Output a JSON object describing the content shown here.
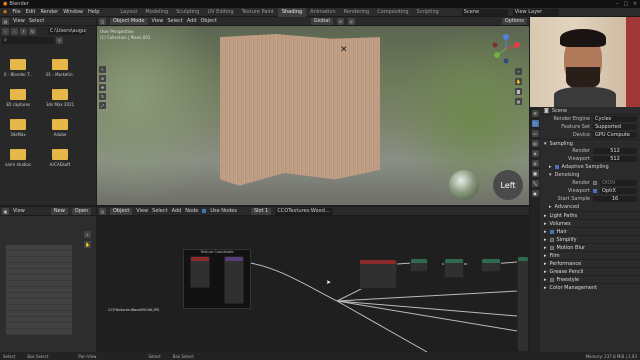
{
  "window": {
    "title": "Blender"
  },
  "menu": {
    "items": [
      "File",
      "Edit",
      "Render",
      "Window",
      "Help"
    ]
  },
  "workspaces": [
    "Layout",
    "Modeling",
    "Sculpting",
    "UV Editing",
    "Texture Paint",
    "Shading",
    "Animation",
    "Rendering",
    "Compositing",
    "Scripting"
  ],
  "active_workspace": "Shading",
  "top_right": {
    "scene": "Scene",
    "view_layer": "View Layer"
  },
  "file_browser": {
    "header": {
      "view": "View",
      "select": "Select"
    },
    "path": "C:\\Users\\august\\...",
    "items": [
      {
        "name": "0 - Blender T..."
      },
      {
        "name": "01 - Marketin..."
      },
      {
        "name": "3D captures"
      },
      {
        "name": "3ds Max 2021"
      },
      {
        "name": "3dsMax"
      },
      {
        "name": "Adobe"
      },
      {
        "name": "anim studios"
      },
      {
        "name": "ArCADsoft"
      }
    ]
  },
  "image_editor": {
    "view": "View",
    "new": "New",
    "open": "Open"
  },
  "viewport": {
    "mode": "Object Mode",
    "menu": [
      "View",
      "Select",
      "Add",
      "Object"
    ],
    "orientation": "Global",
    "options": "Options",
    "overlay_line1": "User Perspective",
    "overlay_line2": "(1) Collection | Plane.001",
    "left_badge": "Left"
  },
  "shader_editor": {
    "type": "Object",
    "menu": [
      "View",
      "Select",
      "Add",
      "Node"
    ],
    "use_nodes": "Use Nodes",
    "slot": "Slot 1",
    "material": "CCOTextures:Wood...",
    "node_title": "Texture Coordinate",
    "image_caption": "CC0Textures:Wood05O4K.JPG"
  },
  "properties": {
    "scene": "Scene",
    "render_engine_label": "Render Engine",
    "render_engine": "Cycles",
    "feature_set_label": "Feature Set",
    "feature_set": "Supported",
    "device_label": "Device",
    "device": "GPU Compute",
    "sampling": "Sampling",
    "render_label": "Render",
    "render_samples": "512",
    "viewport_label": "Viewport",
    "viewport_samples": "512",
    "adaptive": "Adaptive Sampling",
    "denoising": "Denoising",
    "dn_render_label": "Render",
    "dn_render": "OIDN",
    "dn_viewport_label": "Viewport",
    "dn_viewport": "OptiX",
    "start_sample_label": "Start Sample",
    "start_sample": "16",
    "advanced": "Advanced",
    "sections": [
      "Light Paths",
      "Volumes",
      "Hair",
      "Simplify",
      "Motion Blur",
      "Film",
      "Performance",
      "Grease Pencil",
      "Freestyle",
      "Color Management"
    ]
  },
  "status": {
    "items": [
      "Select",
      "Box Select",
      "Pan View",
      "Select",
      "Box Select"
    ],
    "memory": "Memory: 237.8 MiB | 2.93"
  },
  "colors": {
    "accent": "#4772b3",
    "folder": "#e6b84a",
    "node_green": "#2e6b4e",
    "node_red": "#8a2a2a",
    "node_purple": "#5a3b7a"
  }
}
